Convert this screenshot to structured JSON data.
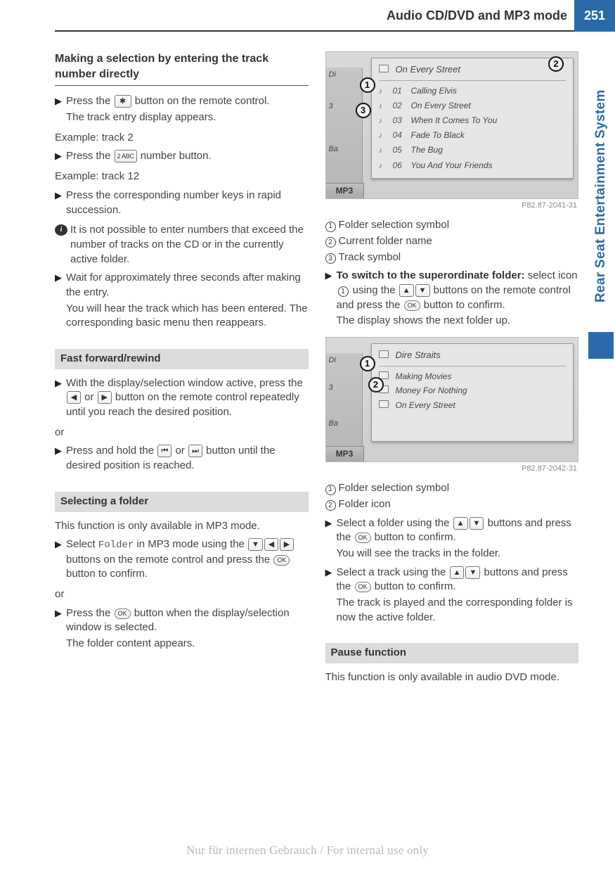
{
  "header": {
    "title": "Audio CD/DVD and MP3 mode",
    "page": "251"
  },
  "sideTab": "Rear Seat Entertainment System",
  "left": {
    "sect1_title": "Making a selection by entering the track number directly",
    "s1": "Press the ",
    "s1b": " button on the remote control.",
    "s1c": "The track entry display appears.",
    "ex1": "Example: track 2",
    "s2": "Press the ",
    "s2b": " number button.",
    "ex2": "Example: track 12",
    "s3": "Press the corresponding number keys in rapid succession.",
    "info1": "It is not possible to enter numbers that exceed the number of tracks on the CD or in the currently active folder.",
    "s4a": "Wait for approximately three seconds after making the entry.",
    "s4b": "You will hear the track which has been entered. The corresponding basic menu then reappears.",
    "sect2_title": "Fast forward/rewind",
    "ff1a": "With the display/selection window active, press the ",
    "ff1b": " or ",
    "ff1c": " button on the remote control repeatedly until you reach the desired position.",
    "or": "or",
    "ff2a": "Press and hold the ",
    "ff2b": " or ",
    "ff2c": " button until the desired position is reached.",
    "sect3_title": "Selecting a folder",
    "sf_intro": "This function is only available in MP3 mode.",
    "sf1a": "Select ",
    "sf1_folder": "Folder",
    "sf1b": " in MP3 mode using the ",
    "sf1c": " buttons on the remote control and press the ",
    "sf1d": " button to confirm.",
    "sf2a": "Press the ",
    "sf2b": " button when the display/selection window is selected.",
    "sf2c": "The folder content appears."
  },
  "right": {
    "fig1_caption": "P82.87-2041-31",
    "fig1_title": "On Every Street",
    "fig1_tracks": [
      {
        "n": "01",
        "t": "Calling Elvis"
      },
      {
        "n": "02",
        "t": "On Every Street"
      },
      {
        "n": "03",
        "t": "When It Comes To You"
      },
      {
        "n": "04",
        "t": "Fade To Black"
      },
      {
        "n": "05",
        "t": "The Bug"
      },
      {
        "n": "06",
        "t": "You And Your Friends"
      }
    ],
    "legend1": [
      "Folder selection symbol",
      "Current folder name",
      "Track symbol"
    ],
    "sw_a": "To switch to the superordinate folder:",
    "sw_b": " select icon ",
    "sw_c": " using the ",
    "sw_d": " buttons on the remote control and press the ",
    "sw_e": " button to confirm.",
    "sw_f": "The display shows the next folder up.",
    "fig2_caption": "P82.87-2042-31",
    "fig2_title": "Dire Straits",
    "fig2_folders": [
      "Making Movies",
      "Money For Nothing",
      "On Every Street"
    ],
    "legend2": [
      "Folder selection symbol",
      "Folder icon"
    ],
    "sf3a": "Select a folder using the ",
    "sf3b": " buttons and press the ",
    "sf3c": " button to confirm.",
    "sf3d": "You will see the tracks in the folder.",
    "sf4a": "Select a track using the ",
    "sf4b": " buttons and press the ",
    "sf4c": " button to confirm.",
    "sf4d": "The track is played and the corresponding folder is now the active folder.",
    "sect4_title": "Pause function",
    "pf_intro": "This function is only available in audio DVD mode."
  },
  "buttons": {
    "star": "✱",
    "two": "2 ABC",
    "left": "◀",
    "right": "▶",
    "up": "▲",
    "down": "▼",
    "skipb": "⏮",
    "skipf": "⏭",
    "ok": "OK"
  },
  "mp3": "MP3",
  "leftstrip": {
    "a": "Di",
    "b": "3",
    "c": "Ba"
  },
  "footer": "Nur für internen Gebrauch / For internal use only"
}
